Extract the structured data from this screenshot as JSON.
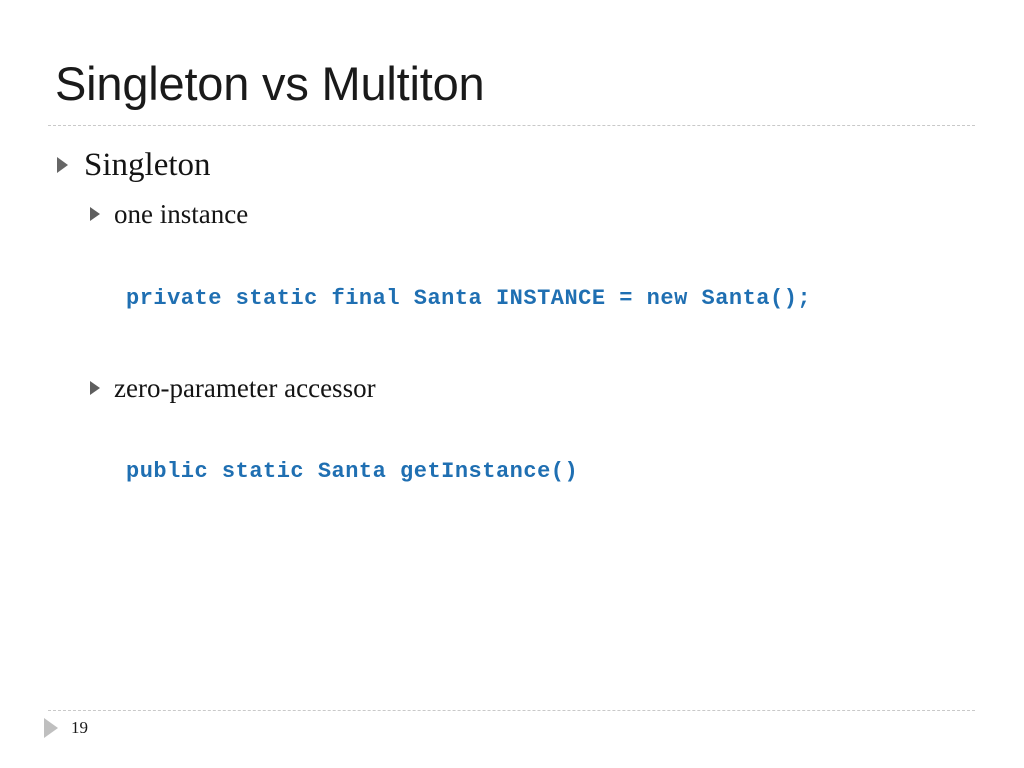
{
  "slide": {
    "title": "Singleton vs Multiton",
    "page_number": "19",
    "accent_color": "#1f6fb2",
    "bullet_color": "#666666",
    "footer_marker_color": "#bfbfbf",
    "rule_color": "#c9c9c9",
    "background_color": "#ffffff"
  },
  "content": {
    "bullets": [
      {
        "level": 1,
        "text": "Singleton"
      },
      {
        "level": 2,
        "text": "one instance"
      },
      {
        "level": 2,
        "text": "zero-parameter accessor"
      }
    ],
    "code_lines": [
      "private static final Santa INSTANCE = new Santa();",
      "public static Santa getInstance()"
    ]
  }
}
